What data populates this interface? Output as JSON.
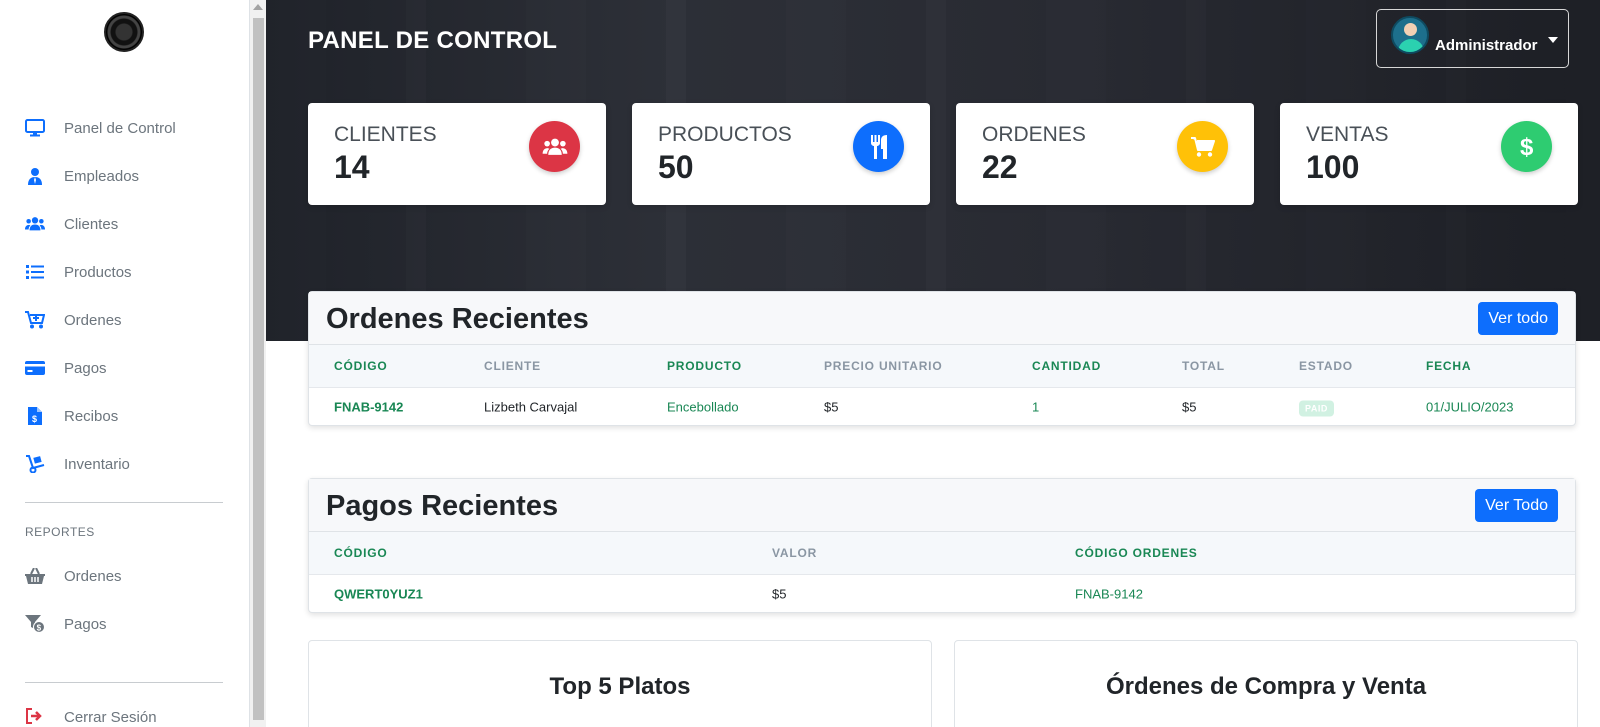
{
  "sidebar": {
    "items": [
      {
        "label": "Panel de Control",
        "icon": "monitor-icon"
      },
      {
        "label": "Empleados",
        "icon": "user-tie-icon"
      },
      {
        "label": "Clientes",
        "icon": "users-icon"
      },
      {
        "label": "Productos",
        "icon": "list-icon"
      },
      {
        "label": "Ordenes",
        "icon": "cart-icon"
      },
      {
        "label": "Pagos",
        "icon": "credit-card-icon"
      },
      {
        "label": "Recibos",
        "icon": "receipt-icon"
      },
      {
        "label": "Inventario",
        "icon": "dolly-icon"
      }
    ],
    "reports_heading": "REPORTES",
    "reports": [
      {
        "label": "Ordenes",
        "icon": "basket-icon"
      },
      {
        "label": "Pagos",
        "icon": "filter-dollar-icon"
      }
    ],
    "logout": {
      "label": "Cerrar Sesión",
      "icon": "sign-out-icon"
    }
  },
  "header": {
    "title": "PANEL DE CONTROL",
    "user": "Administrador"
  },
  "stats": [
    {
      "label": "CLIENTES",
      "value": "14",
      "icon": "users-icon",
      "color": "#dc3545"
    },
    {
      "label": "PRODUCTOS",
      "value": "50",
      "icon": "utensils-icon",
      "color": "#0d6efd"
    },
    {
      "label": "ORDENES",
      "value": "22",
      "icon": "cart-icon",
      "color": "#ffc107"
    },
    {
      "label": "VENTAS",
      "value": "100",
      "icon": "dollar-icon",
      "color": "#2ecc71"
    }
  ],
  "orders": {
    "title": "Ordenes Recientes",
    "button": "Ver todo",
    "columns": [
      "CÓDIGO",
      "CLIENTE",
      "PRODUCTO",
      "PRECIO UNITARIO",
      "CANTIDAD",
      "TOTAL",
      "ESTADO",
      "FECHA"
    ],
    "rows": [
      {
        "codigo": "FNAB-9142",
        "cliente": "Lizbeth Carvajal",
        "producto": "Encebollado",
        "precio": "$5",
        "cantidad": "1",
        "total": "$5",
        "estado": "PAID",
        "fecha": "01/JULIO/2023"
      }
    ]
  },
  "payments": {
    "title": "Pagos Recientes",
    "button": "Ver Todo",
    "columns": [
      "CÓDIGO",
      "VALOR",
      "CÓDIGO ORDENES"
    ],
    "rows": [
      {
        "codigo": "QWERT0YUZ1",
        "valor": "$5",
        "orden": "FNAB-9142"
      }
    ]
  },
  "charts": {
    "left_title": "Top 5 Platos",
    "right_title": "Órdenes de Compra y Venta"
  }
}
